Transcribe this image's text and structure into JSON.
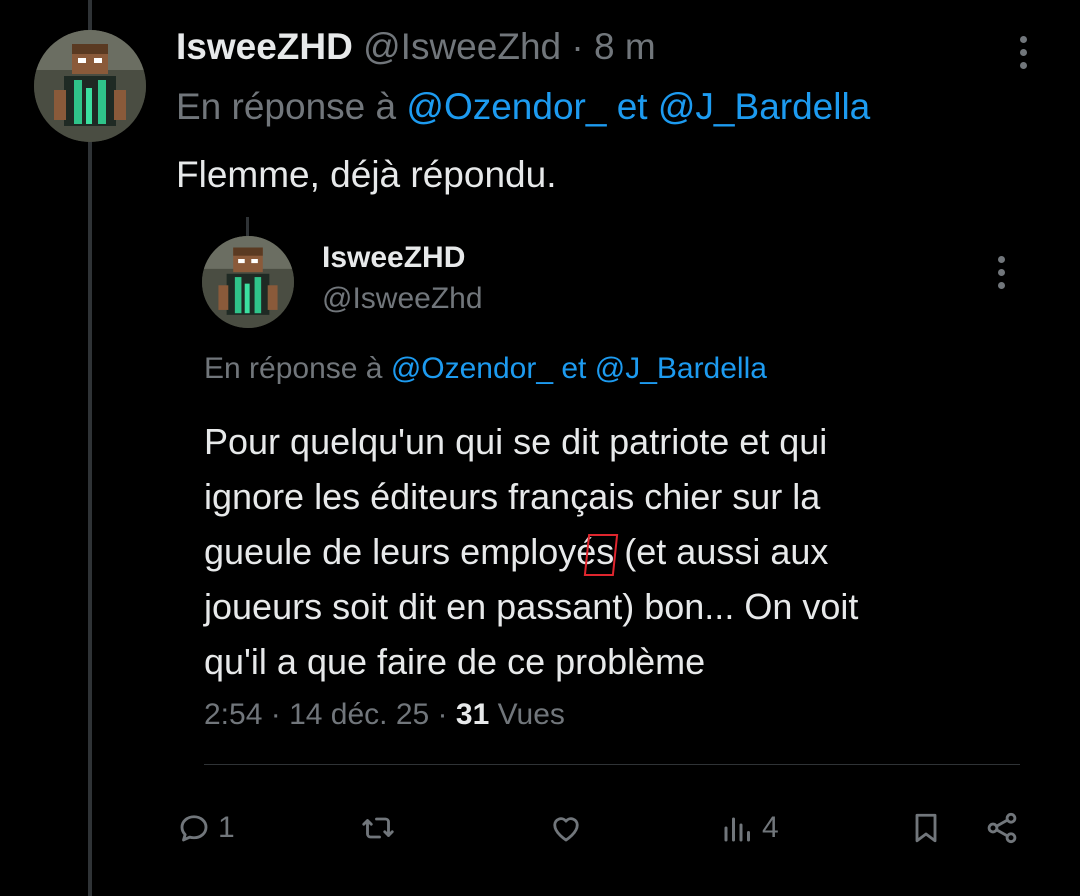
{
  "tweet": {
    "author_name": "IsweeZHD",
    "author_handle": "@IsweeZhd",
    "time": "8 m",
    "reply_prefix": "En réponse à",
    "reply_to_1": "@Ozendor_",
    "reply_joiner": "et",
    "reply_to_2": "@J_Bardella",
    "text": "Flemme, déjà répondu."
  },
  "quoted": {
    "author_name": "IsweeZHD",
    "author_handle": "@IsweeZhd",
    "reply_prefix": "En réponse à",
    "reply_to_1": "@Ozendor_",
    "reply_joiner": "et",
    "reply_to_2": "@J_Bardella",
    "lines": [
      "Pour quelqu'un qui se dit patriote et qui",
      "ignore les éditeurs français chier sur la",
      "gueule de leurs employés",
      "(et aussi aux",
      "joueurs soit dit en passant) bon... On voit",
      "qu'il a que faire de ce problème"
    ],
    "time": "2:54",
    "date": "14 déc. 25",
    "views_count": "31",
    "views_label": "Vues"
  },
  "actions": {
    "reply_count": "1",
    "retweet_count": "",
    "like_count": "",
    "views_count": "4"
  },
  "colors": {
    "background": "#000000",
    "text": "#e7e9ea",
    "muted": "#71767b",
    "link": "#1d9bf0",
    "annotation": "#e0262e"
  },
  "icons": [
    "more-icon",
    "reply-icon",
    "retweet-icon",
    "like-icon",
    "views-icon",
    "bookmark-icon",
    "share-icon"
  ]
}
